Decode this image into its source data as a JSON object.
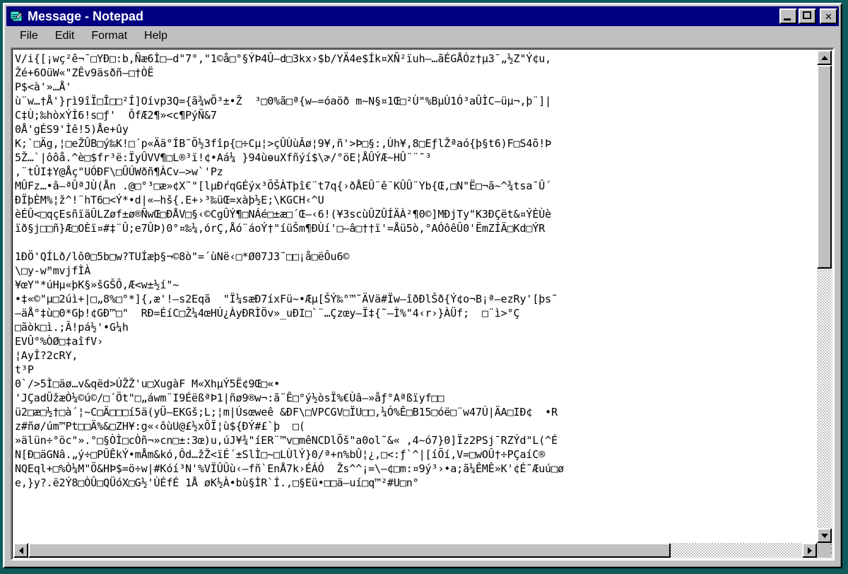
{
  "window": {
    "title": "Message - Notepad",
    "icon": "notepad-icon",
    "titlebar_color": "#000080",
    "face_color": "#c0c0c0",
    "desktop_color": "#0d5b5b",
    "buttons": {
      "minimize": "_",
      "maximize": "□",
      "close": "✕"
    }
  },
  "menu": {
    "items": [
      {
        "label": "File"
      },
      {
        "label": "Edit"
      },
      {
        "label": "Format"
      },
      {
        "label": "Help"
      }
    ]
  },
  "document": {
    "lines": [
      "V/i{[¡wç²ê¬¯□YÐ□:b,Ñæ6Ì□–d\"7°,\"1©å□°§ÝÞ4Û–d□3kx›$b/YÄ4e$Ík¤XÑ²ïuh–…ãÉGÅÓz†µ3¯„½Z\"Ý¢u,",
      "Žé+6OüW«\"ZÊv9äsðñ–□†ÒË",
      "P$<à'»…Å'",
      "ù¨w…†Å'}ɼì9îÏ□Î□□²Í]Oívp3Q={ã¾wÕ³±•Ž  ³□0%ã□ª{w–=óaöð m~N§¤1Œ□²Ù\"%BµÙ1Ó³aÛÌC–üµ¬‚þ¨]|",
      "C‡Ù;‰hòxÝÍ6!s□ƒ'  ÔfÆ2¶»<c¶PýÑ&7",
      "0Å'gÉS9'Ìê!5)Åe+ûy",
      "K;`□Äg,¦□eŽÛB□ý‰K!□´p«Ää°ÍB˜Õ½3fîp{□÷Cµ¦>çÛÙùÂø¦9¥‚ñ'>Þ□§:‚Ùh¥‚8□EƒlŽªaó{þ§t6)F□S4õ!Þ",
      "5Ž…`|ôôå.^è□$fr³ë:ÏyÛVV¶□L®³ï!¢•Aá¼ }94ùɵuXfñýí$\\ɚ/°öE¦ÅÛÝÆ~HÛ¨¨˜³",
      "‚¨tÛI‡Y@Åç\"UÓÐF\\□ÛÚWðñ¶ÀCv–>w`'Pz",
      "MÛFz…•â–ªÛªJÙ(Ån .@□°³□æ»¢X˜\"[lµÐŕqGÉýx³ÕŠÀTþî€¨t7q{›ðÅEÛ¨ê¨ΚÛÛ¨Yb{Œ‚□N\"Ë□¬ã~^¾tsa¯Û´",
      "ÐÏþÈM%¦ž^!¨hT6□<Ý*•d|«–hš{.E+›³‰üŒ=xàþ½E;\\KGCH‹^U",
      "èÉÛ<□qçEsñïäÛLZøf±ø®ÑwŒ□ÐÅV□§‹©CgÛÝ¶□NÁé□±æ□´Œ–‹6!(¥3scùÛZÛÍÄÀ²¶0©]MÐjTy\"K3ÐÇët&¤ÝÈÙè",
      "ïð§j□□ñ}Æ□OÈï¤#‡¨Û;e7ÛÞ)0°¤‰¼‚órÇ‚Åó¨áoÝ†\"íüŠm¶ÐÙí'□–â□††ï'=Åü5ò‚°AÓôêÛ0'ËmZÍÄ□Kd□ÝR",
      "",
      "1ÐÖ'QÍLð/lô0□5b□w?TUÍæþ§¬©8ò\"=´ùNë‹□*Ø07J3¯□□¡å□ëÔu6©",
      "\\□y-wᴹmvjfÌÀ",
      "¥œY\"*úHµ«þK§»šGŠÔ‚Æ<w±½í\"~",
      "•‡«©\"µ□2úì+|□„8%□°*]{‚æ'!–s2Eqã  \"Ï¼sæÐ7íxFü~•Æµ[ŠÝ‰°™˜ÄVä#Ïw–îðÐlŠð{Ý¢o¬B¡ª–ezRy'[þs˜",
      "–äÅ°‡ù□0*Gþ!¢GÐ™□\"  RÐ=ÉíC□Ž¼4œHÚ¿ÀyÐRÌÖv»_uÐI□`¨…Çzœy–Ï‡{˜–Ì%\"4‹r›}ÀÜf;  □¨ì>°Ç",
      "□ãòk□ì.;Ă!pá½'•G¼h",
      "EVÛ°%ÒØ□‡aîfV›",
      "¦AyÎ?2cRY‚",
      "t³P",
      "0`/>5Ì□äø…v&qëd>ÚŽŽ'u□XugàF M«XhµÝ5Ë¢9Œ□«•",
      "'JÇadÜžæÒ¼©ú©/□´Öt\"□„áwm¨I9ÉëßªÞ1|ñø9®w¬:ã¨Ê□°ý½òsÏ%€Ùâ–»åƒ°Aªßïyf□□",
      "ü2□æ□½†□à´¦~C□Ä□□□í5ä(yÜ–EKGš;L;¦m|Úsœweê &ÐF\\□VPCGV□ÏU□□,¼Ó%Ê□B15□óë□¨w47Ú|ÄA□IÐ¢  •R",
      "z#ñø/úm™Pt□□Ä%&□ZH¥:g«‹ôùU@£½xÔÏ¦ù${ÐÝ#£`þ  □(",
      "»älün÷°öc\"».°□§ÒÌ□cÒñ¬»cn□±:3œ)u,úJ¥¾\"íER¨™v□mêNCDlÕš\"a0ol˜&« ,4~ó7}0]Ïz2PSj¯RZÝd\"L(^É",
      "N[Ð□äGNâ.„ý÷□PÛÊkÝ•mÅm&kó,Ôd…žŽ<ïÉ´±SlÌ□~□LÙlÝ}0/ª+n%bÛ¦¿‚□<:ƒ`^|[íÕí,V=□wOÛ†÷PÇaíC®",
      "NQEql+□%Ò¼M\"Õ&HÞ$=ö÷w|#Kóí³N'%VÏÛÛù‹–fñ`EnÅ7k›ÉÁÓ  Žs^^¡=\\–¢□m:¤9ý³›•a;ã¼ÊMÊ»K'¢É˜Æuú□ø",
      "e,}y?.ë2Ý8□ÒÛ□QÜóX□G½'ÙÉfÉ 1Å øK½À•bù§ÌR`Í.,□§Eü•□□ä–uí□q™²#U□n°"
    ]
  },
  "scrollbars": {
    "vertical": {
      "up_arrow": "arrow-up",
      "down_arrow": "arrow-down",
      "thumb_top_pct": 0,
      "thumb_height_pct": 44
    },
    "horizontal": {
      "left_arrow": "arrow-left",
      "right_arrow": "arrow-right",
      "thumb_left_pct": 0,
      "thumb_width_pct": 83
    }
  }
}
